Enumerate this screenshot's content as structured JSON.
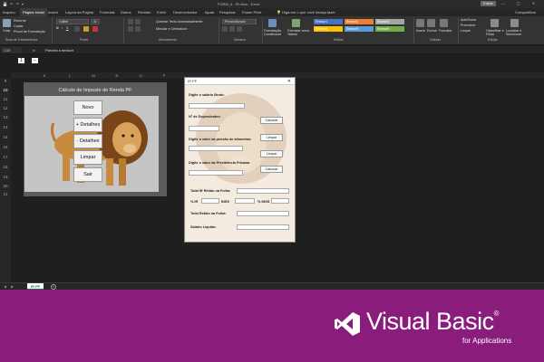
{
  "titlebar": {
    "title": "FORM_4 - IR.xlsm  -  Excel",
    "signin": "Entrar",
    "quick_access": "💾 ↶ ↷ ▾"
  },
  "ribbon_tabs": {
    "arquivo": "Arquivo",
    "pagina_inicial": "Página Inicial",
    "inserir": "Inserir",
    "layout": "Layout da Página",
    "formulas": "Fórmulas",
    "dados": "Dados",
    "revisao": "Revisão",
    "exibir": "Exibir",
    "desenvolvedor": "Desenvolvedor",
    "ajuda": "Ajuda",
    "pesquisar": "Pesquisar",
    "power_pivot": "Power Pivot",
    "tell_me": "💡 Diga-me o que você deseja fazer",
    "share": "Compartilhar"
  },
  "ribbon": {
    "recortar": "Recortar",
    "copiar": "Copiar",
    "pincel": "Pincel de Formatação",
    "colar": "Colar",
    "area_transferencia": "Área de Transferência",
    "font_name": "Calibri",
    "font_size": "11",
    "fonte": "Fonte",
    "quebrar_texto": "Quebrar Texto Automaticamente",
    "mesclar": "Mesclar e Centralizar",
    "alinhamento": "Alinhamento",
    "numero_formato": "Personalizado",
    "numero": "Número",
    "formatacao_condicional": "Formatação Condicional",
    "formatar_tabela": "Formatar como Tabela",
    "estilos": "Estilos",
    "style1": "Ênfase1",
    "style2": "Ênfase2",
    "style3": "Ênfase3",
    "style4": "Ênfase4",
    "style5": "Ênfase5",
    "style6": "Ênfase6",
    "inserir": "Inserir",
    "excluir": "Excluir",
    "formatar": "Formatar",
    "celulas": "Células",
    "autosoma": "AutoSoma",
    "preencher": "Preencher",
    "limpar": "Limpar",
    "classificar": "Classificar e Filtrar",
    "localizar": "Localizar e Selecionar",
    "edicao": "Edição",
    "colors": {
      "s1": "#4472c4",
      "s2": "#ed7d31",
      "s3": "#a5a5a5",
      "s4": "#ffc000",
      "s5": "#5b9bd5",
      "s6": "#70ad47"
    }
  },
  "formula_bar": {
    "name_box": "C10",
    "fx": "fx",
    "formula": "Parcela a deduzir"
  },
  "grid": {
    "columns": [
      "K",
      "L",
      "M",
      "N",
      "O",
      "P"
    ],
    "rows": [
      "10",
      "11",
      "12",
      "13",
      "14",
      "15",
      "16",
      "17",
      "18",
      "19",
      "20",
      "21"
    ],
    "top_rows": [
      "9"
    ]
  },
  "sheet_panel": {
    "title": "Cálculo de Imposto de Renda PF",
    "btn_novo": "Novo",
    "btn_mais_detalhes": "+ Detalhes",
    "btn_menos_detalhes": "- Detalhes",
    "btn_limpar": "Limpar",
    "btn_sair": "Sair"
  },
  "userform": {
    "title": "IR PF",
    "lbl_salario": "Digite o salário Bruto:",
    "lbl_dependentes": "Nº de Dependentes:",
    "lbl_pensao": "Digite o valor da pensão de alimentos:",
    "lbl_previdencia": "Digite o valor da Previdência Privada:",
    "lbl_total_retido": "Total IR Retido na Folha:",
    "lbl_pct_ir": "% IR",
    "lbl_inss": "INSS",
    "lbl_pct_inss": "% INSS",
    "lbl_total_retido2": "Total Retido na Folha:",
    "lbl_liquido": "Salário Líquido:",
    "btn_calcular1": "Calcular",
    "btn_limpar1": "Limpar",
    "btn_limpar2": "Limpar",
    "btn_calcular2": "Calcular"
  },
  "sheet_tabs": {
    "active": "IR PF"
  },
  "banner": {
    "title": "Visual Basic",
    "registered": "®",
    "subtitle": "for Applications"
  }
}
